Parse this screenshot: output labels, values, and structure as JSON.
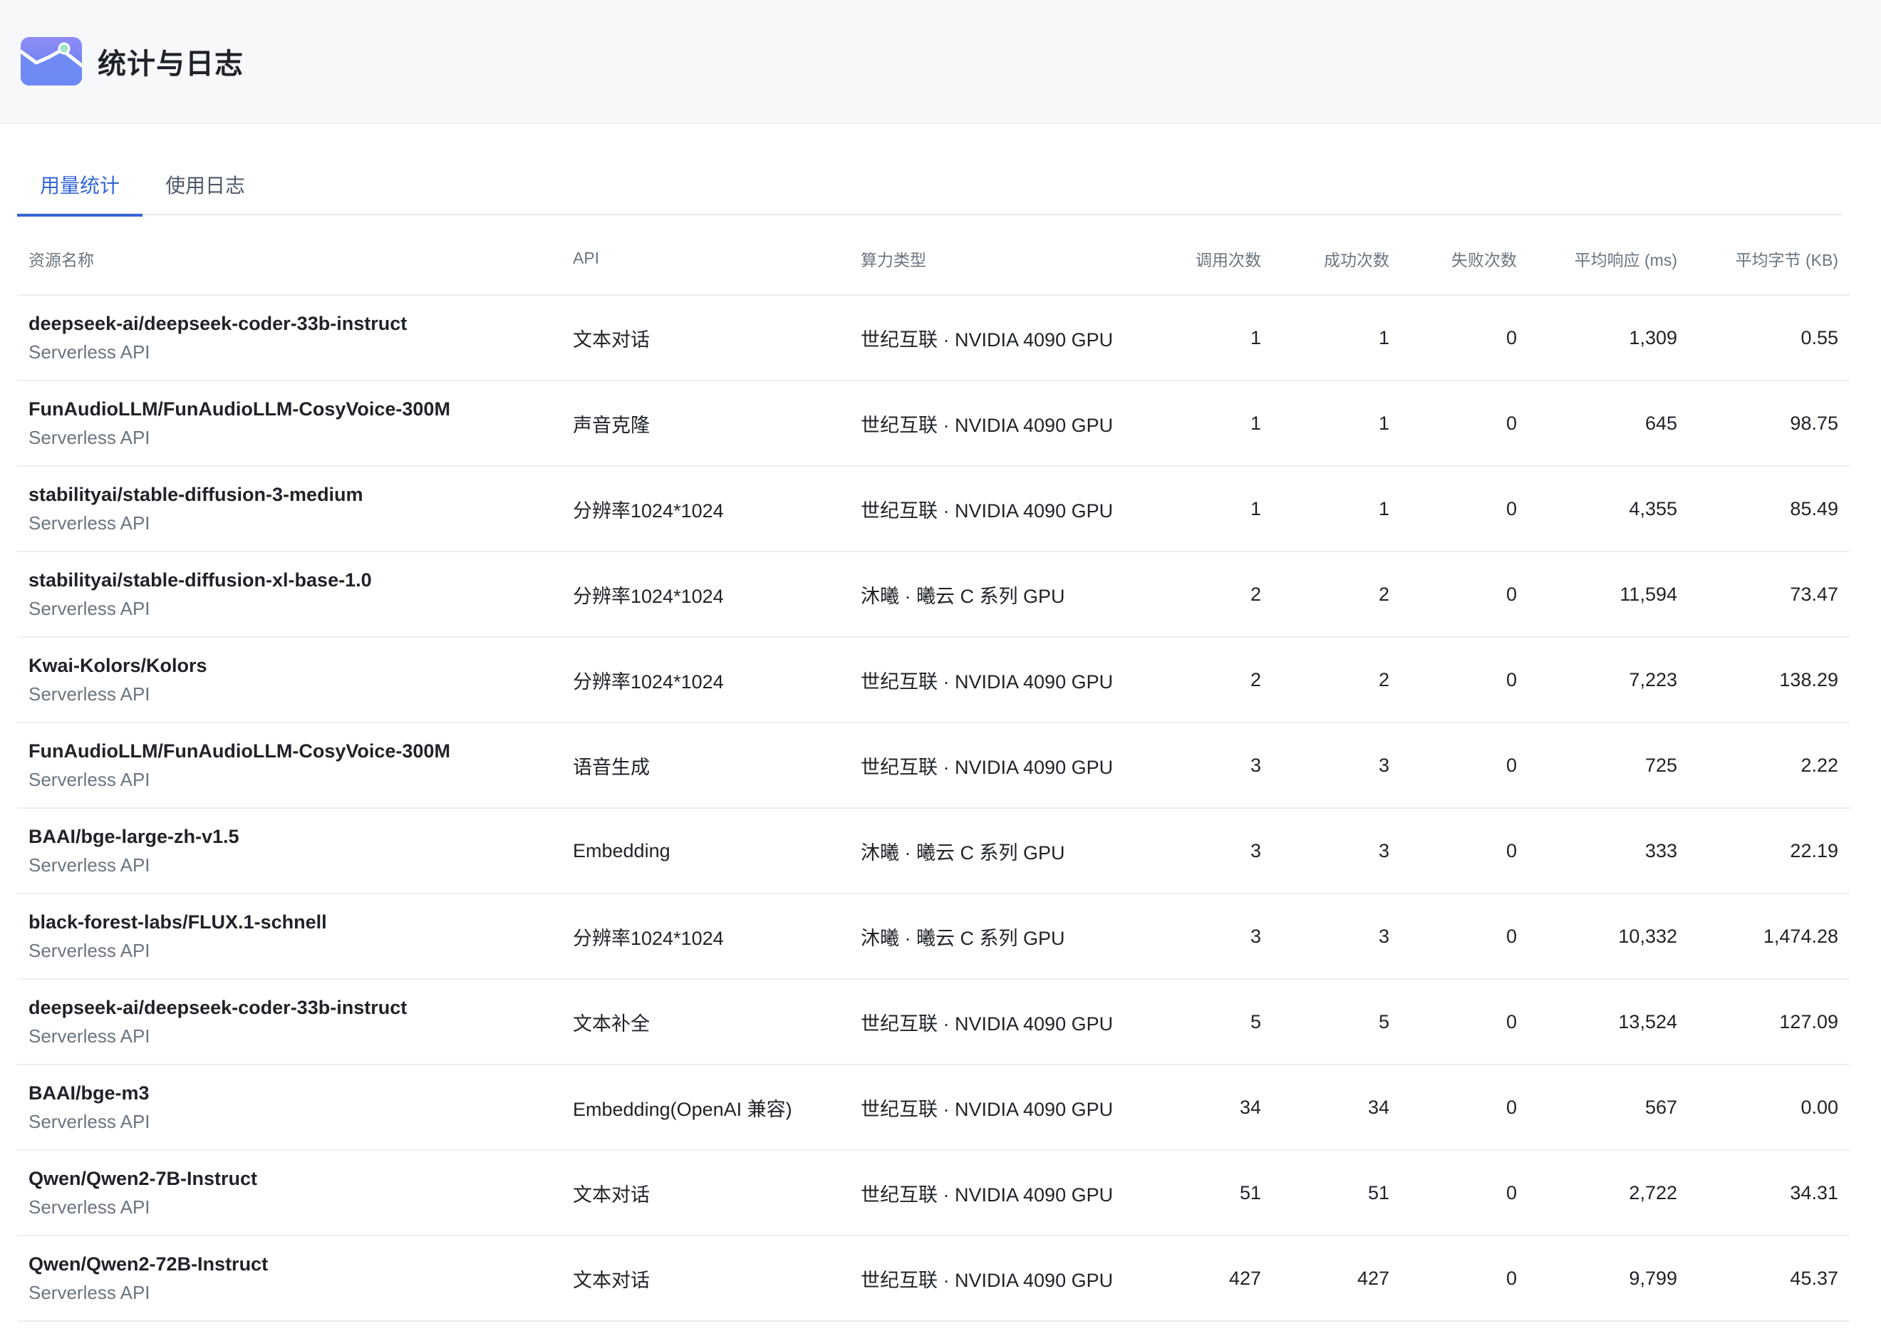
{
  "header": {
    "title": "统计与日志"
  },
  "tabs": [
    {
      "label": "用量统计",
      "active": true
    },
    {
      "label": "使用日志",
      "active": false
    }
  ],
  "table": {
    "columns": [
      "资源名称",
      "API",
      "算力类型",
      "调用次数",
      "成功次数",
      "失败次数",
      "平均响应 (ms)",
      "平均字节 (KB)"
    ],
    "rows": [
      {
        "name": "deepseek-ai/deepseek-coder-33b-instruct",
        "type": "Serverless API",
        "api": "文本对话",
        "compute": "世纪互联 · NVIDIA 4090 GPU",
        "calls": "1",
        "success": "1",
        "failed": "0",
        "avg_ms": "1,309",
        "avg_kb": "0.55"
      },
      {
        "name": "FunAudioLLM/FunAudioLLM-CosyVoice-300M",
        "type": "Serverless API",
        "api": "声音克隆",
        "compute": "世纪互联 · NVIDIA 4090 GPU",
        "calls": "1",
        "success": "1",
        "failed": "0",
        "avg_ms": "645",
        "avg_kb": "98.75"
      },
      {
        "name": "stabilityai/stable-diffusion-3-medium",
        "type": "Serverless API",
        "api": "分辨率1024*1024",
        "compute": "世纪互联 · NVIDIA 4090 GPU",
        "calls": "1",
        "success": "1",
        "failed": "0",
        "avg_ms": "4,355",
        "avg_kb": "85.49"
      },
      {
        "name": "stabilityai/stable-diffusion-xl-base-1.0",
        "type": "Serverless API",
        "api": "分辨率1024*1024",
        "compute": "沐曦 · 曦云 C 系列 GPU",
        "calls": "2",
        "success": "2",
        "failed": "0",
        "avg_ms": "11,594",
        "avg_kb": "73.47"
      },
      {
        "name": "Kwai-Kolors/Kolors",
        "type": "Serverless API",
        "api": "分辨率1024*1024",
        "compute": "世纪互联 · NVIDIA 4090 GPU",
        "calls": "2",
        "success": "2",
        "failed": "0",
        "avg_ms": "7,223",
        "avg_kb": "138.29"
      },
      {
        "name": "FunAudioLLM/FunAudioLLM-CosyVoice-300M",
        "type": "Serverless API",
        "api": "语音生成",
        "compute": "世纪互联 · NVIDIA 4090 GPU",
        "calls": "3",
        "success": "3",
        "failed": "0",
        "avg_ms": "725",
        "avg_kb": "2.22"
      },
      {
        "name": "BAAI/bge-large-zh-v1.5",
        "type": "Serverless API",
        "api": "Embedding",
        "compute": "沐曦 · 曦云 C 系列 GPU",
        "calls": "3",
        "success": "3",
        "failed": "0",
        "avg_ms": "333",
        "avg_kb": "22.19"
      },
      {
        "name": "black-forest-labs/FLUX.1-schnell",
        "type": "Serverless API",
        "api": "分辨率1024*1024",
        "compute": "沐曦 · 曦云 C 系列 GPU",
        "calls": "3",
        "success": "3",
        "failed": "0",
        "avg_ms": "10,332",
        "avg_kb": "1,474.28"
      },
      {
        "name": "deepseek-ai/deepseek-coder-33b-instruct",
        "type": "Serverless API",
        "api": "文本补全",
        "compute": "世纪互联 · NVIDIA 4090 GPU",
        "calls": "5",
        "success": "5",
        "failed": "0",
        "avg_ms": "13,524",
        "avg_kb": "127.09"
      },
      {
        "name": "BAAI/bge-m3",
        "type": "Serverless API",
        "api": "Embedding(OpenAI 兼容)",
        "compute": "世纪互联 · NVIDIA 4090 GPU",
        "calls": "34",
        "success": "34",
        "failed": "0",
        "avg_ms": "567",
        "avg_kb": "0.00"
      },
      {
        "name": "Qwen/Qwen2-7B-Instruct",
        "type": "Serverless API",
        "api": "文本对话",
        "compute": "世纪互联 · NVIDIA 4090 GPU",
        "calls": "51",
        "success": "51",
        "failed": "0",
        "avg_ms": "2,722",
        "avg_kb": "34.31"
      },
      {
        "name": "Qwen/Qwen2-72B-Instruct",
        "type": "Serverless API",
        "api": "文本对话",
        "compute": "世纪互联 · NVIDIA 4090 GPU",
        "calls": "427",
        "success": "427",
        "failed": "0",
        "avg_ms": "9,799",
        "avg_kb": "45.37"
      }
    ]
  },
  "icons": {
    "logo": "chart-line-logo-icon"
  },
  "colors": {
    "accent": "#3467d6",
    "header_bg": "#f7f8fa"
  }
}
